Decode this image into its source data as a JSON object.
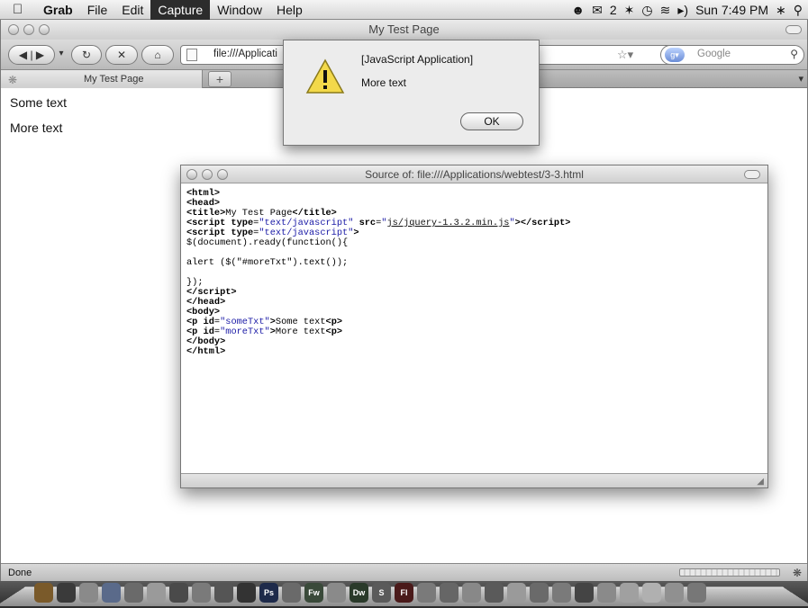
{
  "menubar": {
    "app": "Grab",
    "menus": [
      "File",
      "Edit",
      "Capture",
      "Window",
      "Help"
    ],
    "active_menu": "Capture",
    "mail_count": "2",
    "clock": "Sun 7:49 PM"
  },
  "browser": {
    "window_title": "My Test Page",
    "url": "file:///Applicati",
    "search_placeholder": "Google",
    "tab_label": "My Test Page",
    "new_tab": "+",
    "content": [
      "Some text",
      "More text"
    ],
    "status": "Done"
  },
  "alert": {
    "title": "[JavaScript Application]",
    "message": "More text",
    "ok_label": "OK"
  },
  "source_window": {
    "title": "Source of: file:///Applications/webtest/3-3.html"
  },
  "dock": {
    "icon_labels": [
      "Ps",
      "Fw",
      "Dw",
      "S",
      "Fl"
    ]
  }
}
